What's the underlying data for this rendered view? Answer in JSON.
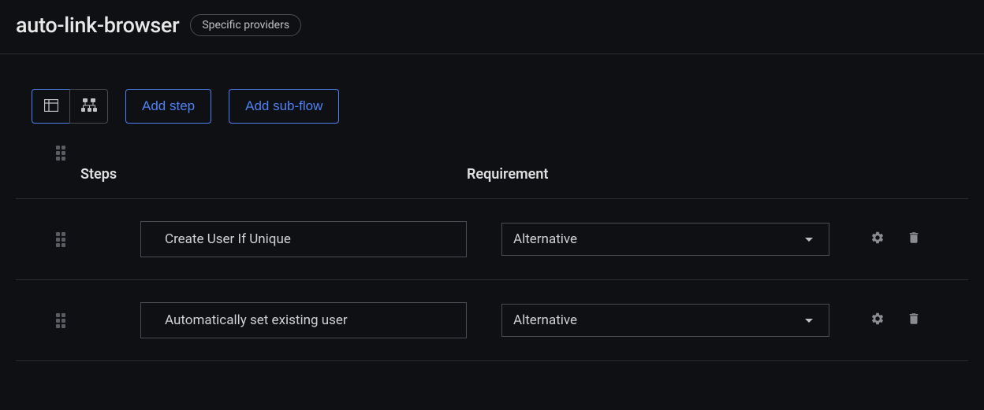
{
  "header": {
    "title": "auto-link-browser",
    "badge": "Specific providers"
  },
  "toolbar": {
    "add_step_label": "Add step",
    "add_sub_flow_label": "Add sub-flow"
  },
  "table": {
    "steps_header": "Steps",
    "requirement_header": "Requirement",
    "rows": [
      {
        "step_name": "Create User If Unique",
        "requirement": "Alternative"
      },
      {
        "step_name": "Automatically set existing user",
        "requirement": "Alternative"
      }
    ]
  }
}
